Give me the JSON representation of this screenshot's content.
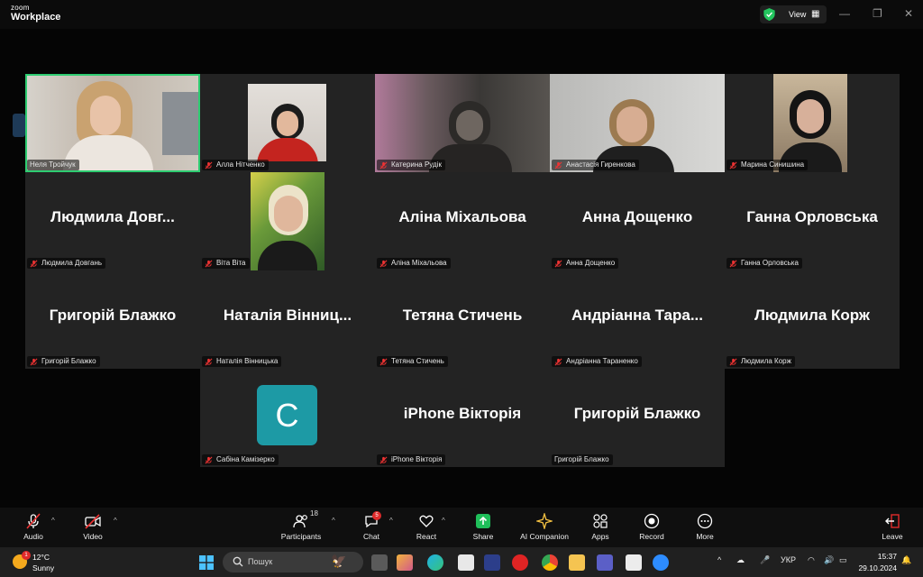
{
  "window": {
    "logo_top": "zoom",
    "logo_bottom": "Workplace",
    "view_label": "View",
    "view_icon": "grid-icon",
    "security_icon": "shield-check-icon"
  },
  "tiles": [
    {
      "big": "",
      "label": "Неля Тройчук",
      "mic": "on"
    },
    {
      "big": "",
      "label": "Алла Нітченко",
      "mic": "muted"
    },
    {
      "big": "",
      "label": "Катерина Рудік",
      "mic": "muted"
    },
    {
      "big": "",
      "label": "Анастасія Гиренкова",
      "mic": "muted"
    },
    {
      "big": "",
      "label": "Марина Синишина",
      "mic": "muted"
    },
    {
      "big": "Людмила Довг...",
      "label": "Людмила Довгань",
      "mic": "muted"
    },
    {
      "big": "",
      "label": "Віта Віта",
      "mic": "muted"
    },
    {
      "big": "Аліна Міхальова",
      "label": "Аліна Міхальова",
      "mic": "muted"
    },
    {
      "big": "Анна Дощенко",
      "label": "Анна Дощенко",
      "mic": "muted"
    },
    {
      "big": "Ганна Орловська",
      "label": "Ганна Орловська",
      "mic": "muted"
    },
    {
      "big": "Григорій Блажко",
      "label": "Григорій Блажко",
      "mic": "muted"
    },
    {
      "big": "Наталія Вінниц...",
      "label": "Наталія Вінницька",
      "mic": "muted"
    },
    {
      "big": "Тетяна Стичень",
      "label": "Тетяна Стичень",
      "mic": "muted"
    },
    {
      "big": "Андріанна Тара...",
      "label": "Андріанна Тараненко",
      "mic": "muted"
    },
    {
      "big": "Людмила Корж",
      "label": "Людмила Корж",
      "mic": "muted"
    },
    {
      "big": "",
      "avatar_letter": "C",
      "label": "Сабіна Камізерко",
      "mic": "muted"
    },
    {
      "big": "iPhone Вікторія",
      "label": "iPhone Вікторія",
      "mic": "muted"
    },
    {
      "big": "Григорій Блажко",
      "label": "Григорій Блажко",
      "mic": "none"
    }
  ],
  "toolbar": {
    "audio": "Audio",
    "video": "Video",
    "participants": "Participants",
    "participants_count": "18",
    "chat": "Chat",
    "chat_badge": "5",
    "react": "React",
    "share": "Share",
    "ai_companion": "AI Companion",
    "apps": "Apps",
    "record": "Record",
    "more": "More",
    "leave": "Leave"
  },
  "taskbar": {
    "weather_temp": "12°C",
    "weather_cond": "Sunny",
    "weather_badge": "1",
    "search_placeholder": "Пошук",
    "lang": "УКР",
    "time": "15:37",
    "date": "29.10.2024"
  },
  "colors": {
    "active_speaker": "#2ecc71",
    "share_green": "#1fbf5a",
    "leave_red": "#e02b2b",
    "avatar_teal": "#1d9aa5"
  }
}
